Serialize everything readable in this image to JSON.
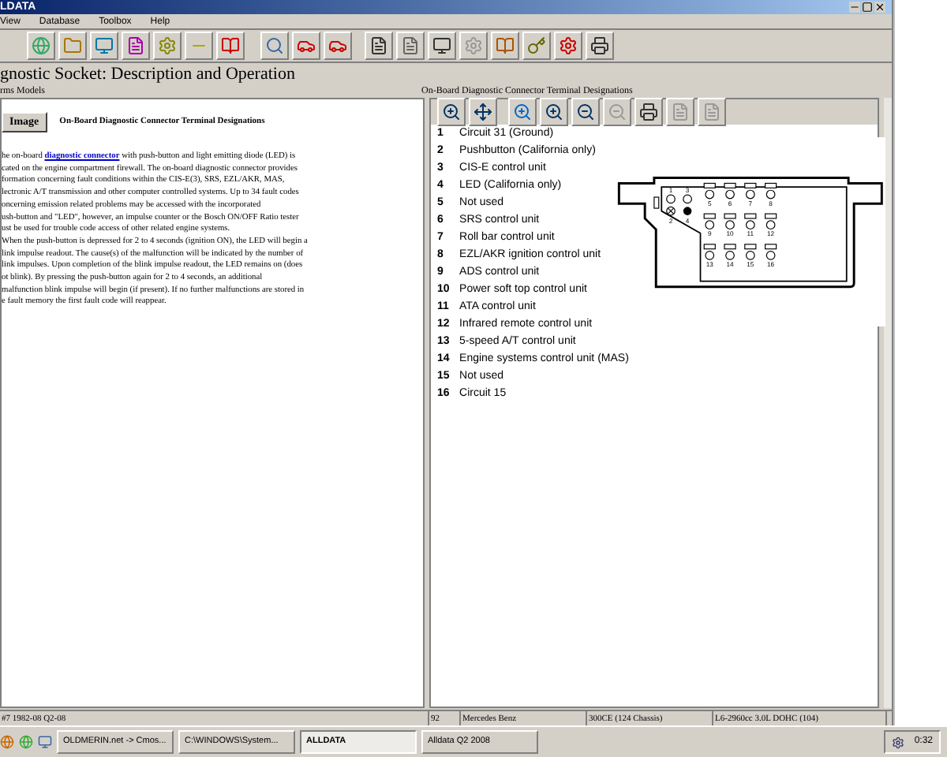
{
  "window": {
    "title": "LDATA"
  },
  "menu": [
    "View",
    "Database",
    "Toolbox",
    "Help"
  ],
  "heading": "gnostic Socket:  Description and Operation",
  "subheading": "rms Models",
  "left_pane": {
    "image_button": "Image",
    "title": "On-Board Diagnostic Connector Terminal Designations",
    "first_line": {
      "before": "he on-board ",
      "link": "diagnostic connector",
      "after": " with push-button and light emitting diode (LED) is"
    },
    "lines": [
      "cated on the engine compartment firewall. The on-board diagnostic connector provides",
      "formation concerning fault conditions within the CIS-E(3), SRS, EZL/AKR, MAS,",
      "lectronic A/T transmission and other computer controlled systems. Up to 34 fault codes",
      "oncerning emission related problems may be accessed with the incorporated",
      "ush-button and \"LED\", however, an impulse counter or the Bosch ON/OFF Ratio tester",
      "ust be used for trouble code access of other related engine systems.",
      "When the push-button is depressed for 2 to 4 seconds (ignition ON), the LED will begin a",
      "link impulse readout. The cause(s) of the malfunction will be indicated by the number of",
      "link impulses. Upon completion of the blink impulse readout, the LED remains on (does",
      "ot blink).  By pressing the push-button again for 2 to 4 seconds, an additional",
      "malfunction blink impulse will begin (if present). If no further malfunctions are stored in",
      "e fault memory the first fault code will reappear."
    ]
  },
  "right_pane": {
    "title": "On-Board Diagnostic Connector Terminal Designations",
    "terminals": [
      {
        "number": "1",
        "label": "Circuit 31 (Ground)"
      },
      {
        "number": "2",
        "label": "Pushbutton (California only)"
      },
      {
        "number": "3",
        "label": "CIS-E control unit"
      },
      {
        "number": "4",
        "label": "LED (California only)"
      },
      {
        "number": "5",
        "label": "Not used"
      },
      {
        "number": "6",
        "label": "SRS control unit"
      },
      {
        "number": "7",
        "label": "Roll bar control unit"
      },
      {
        "number": "8",
        "label": "EZL/AKR ignition control unit"
      },
      {
        "number": "9",
        "label": "ADS control unit"
      },
      {
        "number": "10",
        "label": "Power soft top control unit"
      },
      {
        "number": "11",
        "label": "ATA control unit"
      },
      {
        "number": "12",
        "label": "Infrared remote control unit"
      },
      {
        "number": "13",
        "label": "5-speed A/T control unit"
      },
      {
        "number": "14",
        "label": "Engine systems control unit (MAS)"
      },
      {
        "number": "15",
        "label": "Not used"
      },
      {
        "number": "16",
        "label": "Circuit 15"
      }
    ],
    "pin_labels": [
      "1",
      "3",
      "2",
      "4",
      "5",
      "6",
      "7",
      "8",
      "9",
      "10",
      "11",
      "12",
      "13",
      "14",
      "15",
      "16"
    ]
  },
  "status_bar": [
    "#7 1982-08 Q2-08",
    "92",
    "Mercedes Benz",
    "300CE (124 Chassis)",
    "L6-2960cc 3.0L DOHC (104)"
  ],
  "taskbar": {
    "buttons": [
      {
        "label": "OLDMERIN.net -> Cmos...",
        "selected": false
      },
      {
        "label": "C:\\WINDOWS\\System...",
        "selected": false
      },
      {
        "label": "ALLDATA",
        "selected": true
      },
      {
        "label": "Alldata Q2 2008",
        "selected": false
      }
    ],
    "clock": "0:32"
  }
}
